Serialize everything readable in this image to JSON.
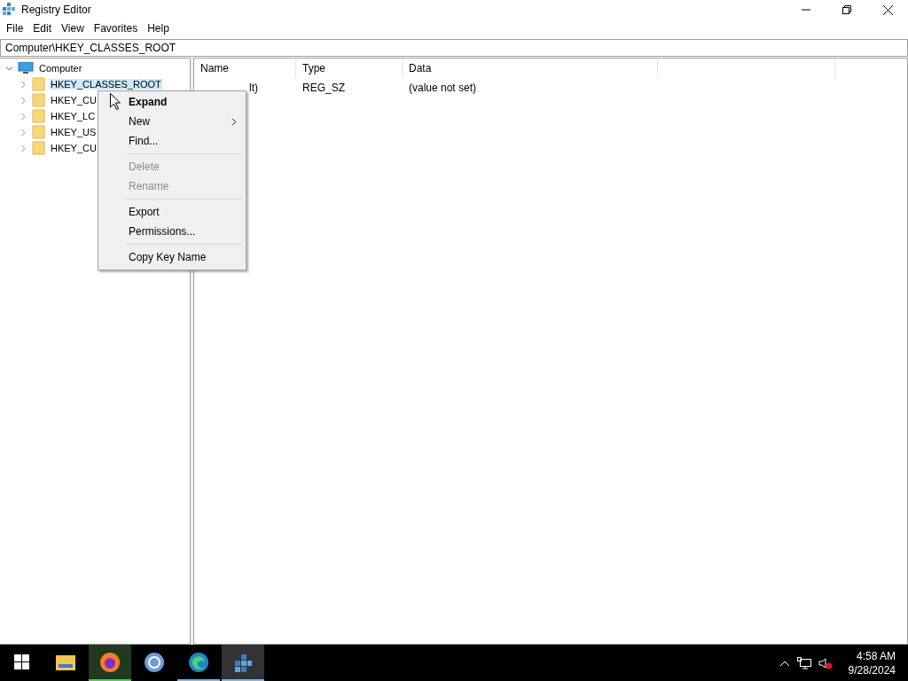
{
  "window": {
    "title": "Registry Editor"
  },
  "menu_bar": [
    "File",
    "Edit",
    "View",
    "Favorites",
    "Help"
  ],
  "address": "Computer\\HKEY_CLASSES_ROOT",
  "tree": [
    {
      "label": "Computer",
      "kind": "computer",
      "expanded": true,
      "selected": false,
      "children": [
        {
          "label": "HKEY_CLASSES_ROOT",
          "kind": "folder",
          "expanded": false,
          "selected": true
        },
        {
          "label": "HKEY_CU",
          "kind": "folder",
          "expanded": false,
          "selected": false
        },
        {
          "label": "HKEY_LC",
          "kind": "folder",
          "expanded": false,
          "selected": false
        },
        {
          "label": "HKEY_US",
          "kind": "folder",
          "expanded": false,
          "selected": false
        },
        {
          "label": "HKEY_CU",
          "kind": "folder",
          "expanded": false,
          "selected": false
        }
      ]
    }
  ],
  "table": {
    "columns": [
      "Name",
      "Type",
      "Data"
    ],
    "rows": [
      {
        "name": "lt)",
        "type": "REG_SZ",
        "data": "(value not set)"
      }
    ]
  },
  "context_menu": [
    {
      "kind": "item",
      "label": "Expand",
      "default": true,
      "disabled": false,
      "submenu": false
    },
    {
      "kind": "item",
      "label": "New",
      "default": false,
      "disabled": false,
      "submenu": true
    },
    {
      "kind": "item",
      "label": "Find...",
      "default": false,
      "disabled": false,
      "submenu": false
    },
    {
      "kind": "separator"
    },
    {
      "kind": "item",
      "label": "Delete",
      "default": false,
      "disabled": true,
      "submenu": false
    },
    {
      "kind": "item",
      "label": "Rename",
      "default": false,
      "disabled": true,
      "submenu": false
    },
    {
      "kind": "separator"
    },
    {
      "kind": "item",
      "label": "Export",
      "default": false,
      "disabled": false,
      "submenu": false
    },
    {
      "kind": "item",
      "label": "Permissions...",
      "default": false,
      "disabled": false,
      "submenu": false
    },
    {
      "kind": "separator"
    },
    {
      "kind": "item",
      "label": "Copy Key Name",
      "default": false,
      "disabled": false,
      "submenu": false
    }
  ],
  "taskbar": {
    "apps": [
      {
        "kind": "explorer",
        "running": false,
        "selected": false,
        "hovered": false
      },
      {
        "kind": "firefox",
        "running": true,
        "selected": false,
        "hovered": true
      },
      {
        "kind": "chrome",
        "running": false,
        "selected": false,
        "hovered": false
      },
      {
        "kind": "edge",
        "running": true,
        "selected": false,
        "hovered": false
      },
      {
        "kind": "regedit",
        "running": true,
        "selected": true,
        "hovered": false
      }
    ],
    "time": "4:58 AM",
    "date": "9/28/2024"
  }
}
